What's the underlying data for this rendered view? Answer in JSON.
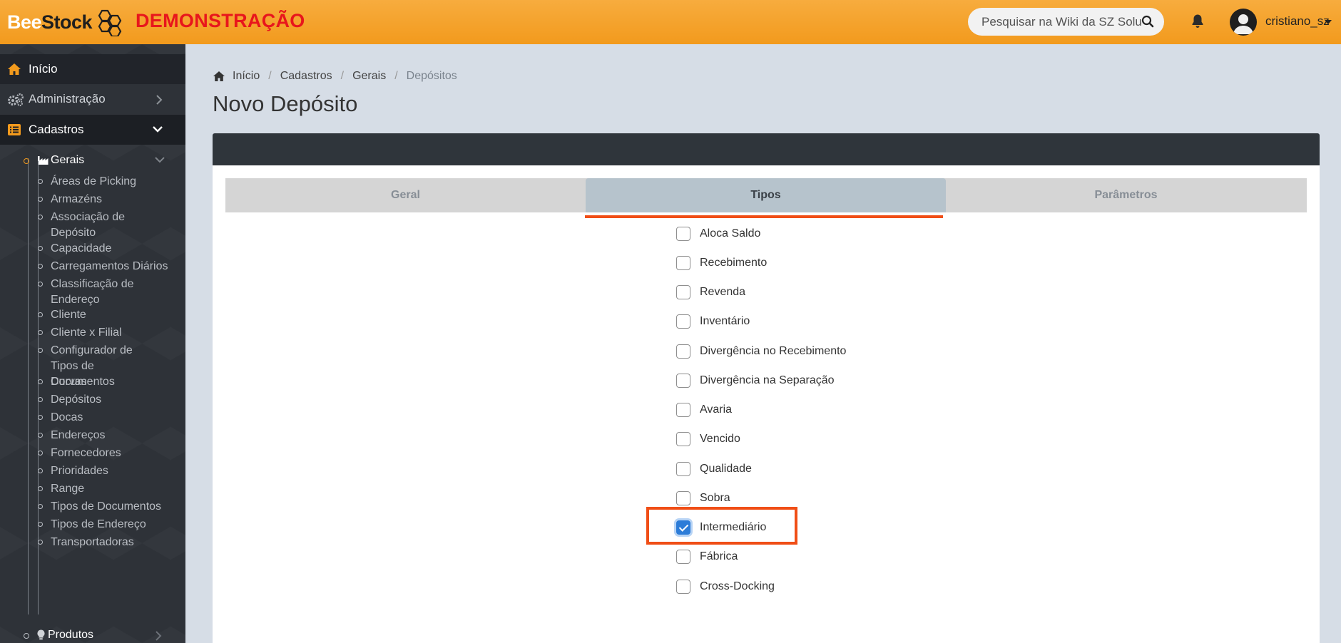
{
  "brand": {
    "bee": "Bee",
    "stock": "Stock",
    "demo": "DEMONSTRAÇÃO"
  },
  "header": {
    "search_placeholder": "Pesquisar na Wiki da SZ Soluções",
    "username": "cristiano_sz"
  },
  "sidebar": {
    "inicio": "Início",
    "administracao": "Administração",
    "cadastros": "Cadastros",
    "gerais": "Gerais",
    "leaves": [
      "Áreas de Picking",
      "Armazéns",
      "Associação de Depósito",
      "Capacidade",
      "Carregamentos Diários",
      "Classificação de Endereço",
      "Cliente",
      "Cliente x Filial",
      "Configurador de Tipos de Documentos",
      "Curvas",
      "Depósitos",
      "Docas",
      "Endereços",
      "Fornecedores",
      "Prioridades",
      "Range",
      "Tipos de Documentos",
      "Tipos de Endereço",
      "Transportadoras"
    ],
    "produtos": "Produtos"
  },
  "breadcrumb": [
    "Início",
    "Cadastros",
    "Gerais",
    "Depósitos"
  ],
  "page_title": "Novo Depósito",
  "tabs": [
    "Geral",
    "Tipos",
    "Parâmetros"
  ],
  "active_tab": "Tipos",
  "tipos": [
    {
      "label": "Aloca Saldo",
      "checked": false
    },
    {
      "label": "Recebimento",
      "checked": false
    },
    {
      "label": "Revenda",
      "checked": false
    },
    {
      "label": "Inventário",
      "checked": false
    },
    {
      "label": "Divergência no Recebimento",
      "checked": false
    },
    {
      "label": "Divergência na Separação",
      "checked": false
    },
    {
      "label": "Avaria",
      "checked": false
    },
    {
      "label": "Vencido",
      "checked": false
    },
    {
      "label": "Qualidade",
      "checked": false
    },
    {
      "label": "Sobra",
      "checked": false
    },
    {
      "label": "Intermediário",
      "checked": true
    },
    {
      "label": "Fábrica",
      "checked": false
    },
    {
      "label": "Cross-Docking",
      "checked": false
    }
  ],
  "colors": {
    "accent": "#f29a1d",
    "highlight": "#f04e16",
    "demo_red": "#e8161c",
    "checkbox_blue": "#2c7cd8"
  }
}
